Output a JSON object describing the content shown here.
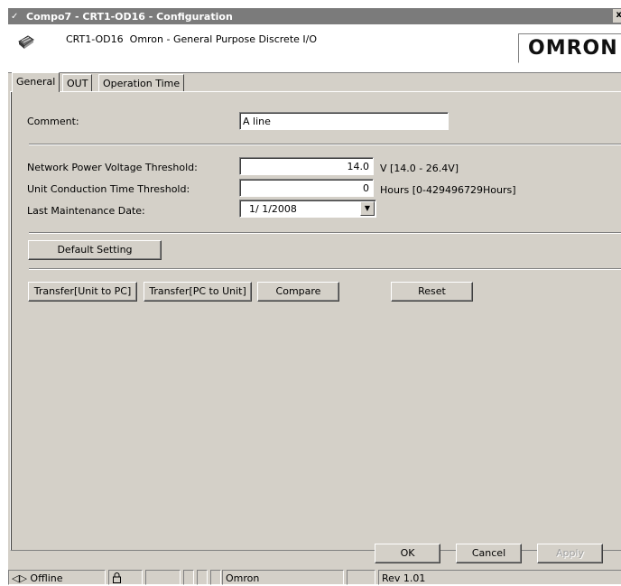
{
  "window": {
    "title": "Compo7 - CRT1-OD16 - Configuration",
    "close_glyph": "x"
  },
  "header": {
    "device_model": "CRT1-OD16",
    "device_description": "Omron - General Purpose Discrete I/O",
    "logo_text": "OMRON"
  },
  "tabs": [
    {
      "label": "General",
      "active": true
    },
    {
      "label": "OUT",
      "active": false
    },
    {
      "label": "Operation Time",
      "active": false
    }
  ],
  "general": {
    "comment_label": "Comment:",
    "comment_value": "A line",
    "voltage_label": "Network Power Voltage Threshold:",
    "voltage_value": "14.0",
    "voltage_range": "V [14.0 - 26.4V]",
    "conduction_label": "Unit Conduction Time Threshold:",
    "conduction_value": "0",
    "conduction_range": "Hours [0-429496729Hours]",
    "maintenance_label": "Last Maintenance Date:",
    "maintenance_value": "1/ 1/2008",
    "default_setting_label": "Default Setting"
  },
  "actions": {
    "transfer_to_pc": "Transfer[Unit to PC]",
    "transfer_to_unit": "Transfer[PC to Unit]",
    "compare": "Compare",
    "reset": "Reset"
  },
  "dialog_buttons": {
    "ok": "OK",
    "cancel": "Cancel",
    "apply": "Apply"
  },
  "status": {
    "connection": "Offline",
    "vendor": "Omron",
    "revision": "Rev 1.01"
  },
  "icons": [
    "app-icon",
    "device-icon",
    "dropdown-arrow-icon",
    "network-arrows-icon",
    "padlock-icon"
  ]
}
